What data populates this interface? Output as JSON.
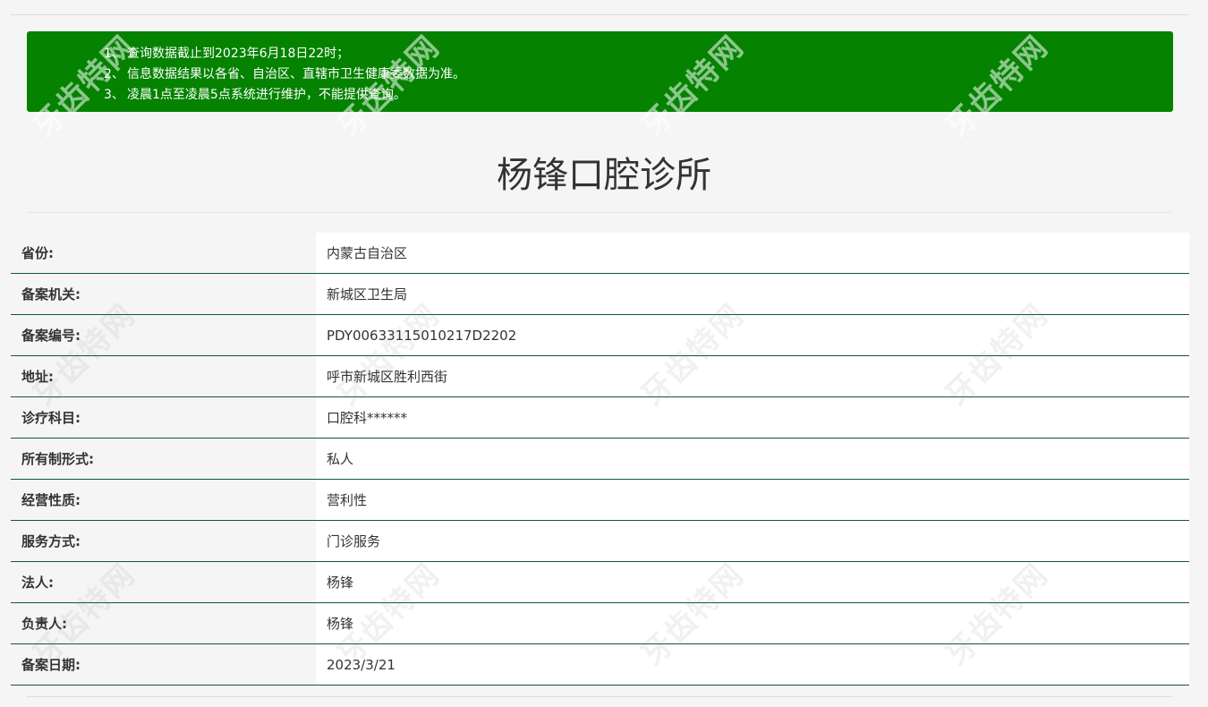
{
  "notice": {
    "items": [
      {
        "num": "1、",
        "text": "查询数据截止到2023年6月18日22时；"
      },
      {
        "num": "2、",
        "text": "信息数据结果以各省、自治区、直辖市卫生健康委数据为准。"
      },
      {
        "num": "3、",
        "text": "凌晨1点至凌晨5点系统进行维护，不能提供查询。"
      }
    ]
  },
  "title": "杨锋口腔诊所",
  "rows": [
    {
      "label": "省份:",
      "value": "内蒙古自治区"
    },
    {
      "label": "备案机关:",
      "value": "新城区卫生局"
    },
    {
      "label": "备案编号:",
      "value": "PDY00633115010217D2202"
    },
    {
      "label": "地址:",
      "value": "呼市新城区胜利西街"
    },
    {
      "label": "诊疗科目:",
      "value": "口腔科******"
    },
    {
      "label": "所有制形式:",
      "value": "私人"
    },
    {
      "label": "经营性质:",
      "value": "营利性"
    },
    {
      "label": "服务方式:",
      "value": "门诊服务"
    },
    {
      "label": "法人:",
      "value": "杨锋"
    },
    {
      "label": "负责人:",
      "value": "杨锋"
    },
    {
      "label": "备案日期:",
      "value": "2023/3/21"
    }
  ],
  "watermark": {
    "text": "牙齿特网"
  },
  "colors": {
    "notice_bg": "#048200",
    "row_border": "#0d5b2c"
  }
}
